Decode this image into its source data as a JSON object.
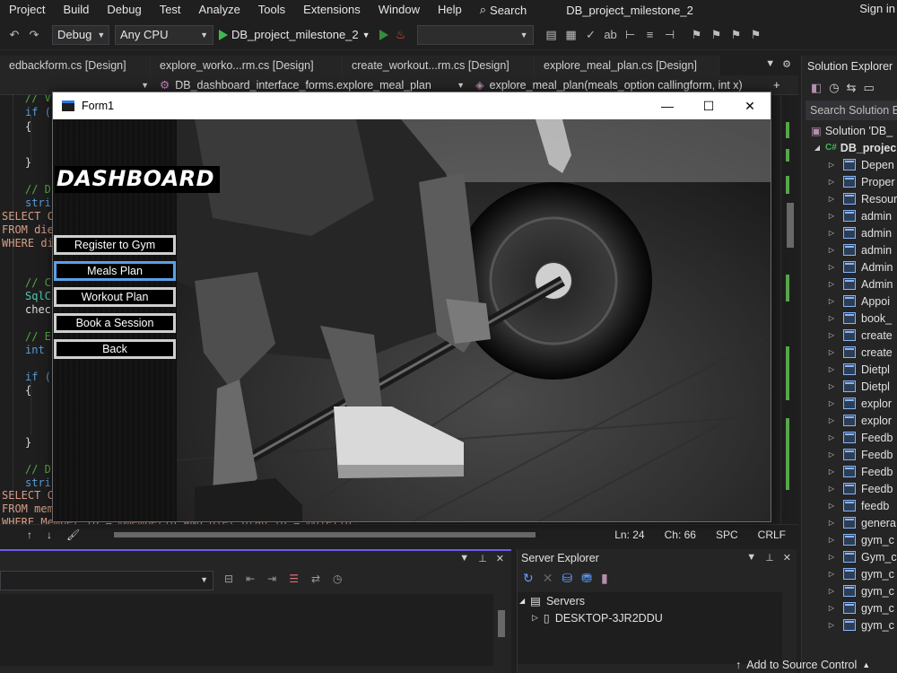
{
  "menu": {
    "items": [
      "Project",
      "Build",
      "Debug",
      "Test",
      "Analyze",
      "Tools",
      "Extensions",
      "Window",
      "Help"
    ],
    "search_label": "Search",
    "solution_name": "DB_project_milestone_2",
    "sign_in": "Sign in"
  },
  "toolbar": {
    "config": "Debug",
    "platform": "Any CPU",
    "run_target": "DB_project_milestone_2"
  },
  "doc_tabs": [
    "edbackform.cs [Design]",
    "explore_worko...rm.cs [Design]",
    "create_workout...rm.cs [Design]",
    "explore_meal_plan.cs [Design]"
  ],
  "navbar": {
    "class_path": "DB_dashboard_interface_forms.explore_meal_plan",
    "member": "explore_meal_plan(meals_option callingform, int x)"
  },
  "code_lines": [
    "// V",
    "if (",
    "{",
    "}",
    "// D",
    "stri",
    "SELECT CO",
    "FROM die",
    "WHERE di",
    "// C",
    "SqlC",
    "chec",
    "// E",
    "int",
    "if (",
    "{",
    "}",
    "// D",
    "stri",
    "SELECT CO",
    "FROM mem",
    "WHERE Member_ID = @memberid AND diet_plan_id = @dietid;"
  ],
  "editor_status": {
    "ln": "Ln: 24",
    "ch": "Ch: 66",
    "spc": "SPC",
    "eol": "CRLF"
  },
  "server_explorer": {
    "title": "Server Explorer",
    "servers_label": "Servers",
    "server_node": "DESKTOP-3JR2DDU"
  },
  "solution_explorer": {
    "title": "Solution Explorer",
    "search_placeholder": "Search Solution Ex",
    "solution_row": "Solution 'DB_",
    "project_row": "DB_projec",
    "items": [
      "Depen",
      "Proper",
      "Resour",
      "admin",
      "admin",
      "admin",
      "Admin",
      "Admin",
      "Appoi",
      "book_",
      "create",
      "create",
      "Dietpl",
      "Dietpl",
      "explor",
      "explor",
      "Feedb",
      "Feedb",
      "Feedb",
      "Feedb",
      "feedb",
      "genera",
      "gym_c",
      "Gym_c",
      "gym_c",
      "gym_c",
      "gym_c",
      "gym_c"
    ]
  },
  "form": {
    "title": "Form1",
    "dashboard_title": "DASHBOARD",
    "buttons": [
      "Register to Gym",
      "Meals Plan",
      "Workout Plan",
      "Book a Session",
      "Back"
    ]
  },
  "bottom_status": {
    "add_to_source_control": "Add to Source Control"
  }
}
